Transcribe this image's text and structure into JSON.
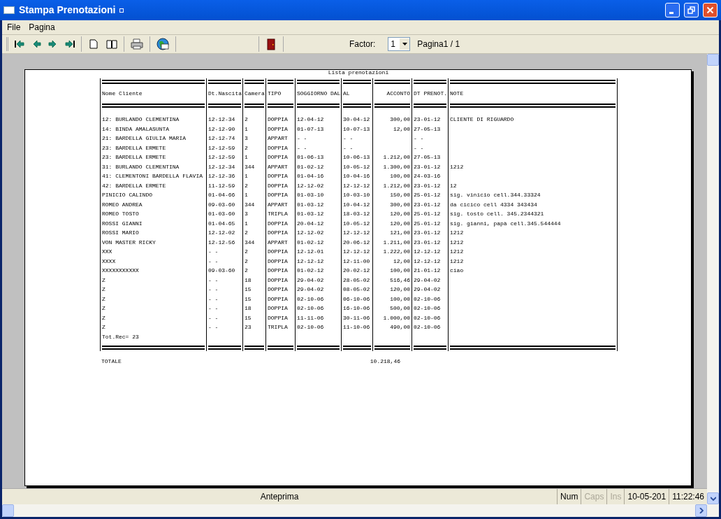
{
  "window": {
    "title": "Stampa Prenotazioni"
  },
  "menu": [
    "File",
    "Pagina"
  ],
  "toolbar": {
    "factor_label": "Factor:",
    "factor_value": "1",
    "page_label": "Pagina1 / 1"
  },
  "report": {
    "title": "Lista prenotazioni",
    "columns": [
      "Nome Cliente",
      "Dt.Nascita",
      "Camera",
      "TIPO",
      "SOGGIORNO DAL",
      "AL",
      "ACCONTO",
      "DT PRENOT.",
      "NOTE"
    ],
    "rows": [
      [
        "12: BURLANDO CLEMENTINA",
        "12-12-34",
        "2",
        "DOPPIA",
        "12-04-12",
        "30-04-12",
        "300,00",
        "23-01-12",
        "CLIENTE DI RIGUARDO"
      ],
      [
        "14: BINDA AMALASUNTA",
        "12-12-90",
        "1",
        "DOPPIA",
        "01-07-13",
        "10-07-13",
        "12,00",
        "27-05-13",
        ""
      ],
      [
        "21: BARDELLA GIULIA MARIA",
        "12-12-74",
        "3",
        "APPART",
        "- -",
        "- -",
        "",
        "- -",
        ""
      ],
      [
        "23: BARDELLA ERMETE",
        "12-12-59",
        "2",
        "DOPPIA",
        "- -",
        "- -",
        "",
        "- -",
        ""
      ],
      [
        "23: BARDELLA ERMETE",
        "12-12-59",
        "1",
        "DOPPIA",
        "01-06-13",
        "10-06-13",
        "1.212,00",
        "27-05-13",
        ""
      ],
      [
        "31: BURLANDO CLEMENTINA",
        "12-12-34",
        "344",
        "APPART",
        "01-02-12",
        "10-05-12",
        "1.300,00",
        "23-01-12",
        "1212"
      ],
      [
        "41: CLEMENTONI BARDELLA FLAVIA",
        "12-12-36",
        "1",
        "DOPPIA",
        "01-04-16",
        "10-04-16",
        "100,00",
        "24-03-16",
        ""
      ],
      [
        "42: BARDELLA ERMETE",
        "11-12-59",
        "2",
        "DOPPIA",
        "12-12-02",
        "12-12-12",
        "1.212,00",
        "23-01-12",
        "12"
      ],
      [
        "PINICIO CALINDO",
        "01-04-66",
        "1",
        "DOPPIA",
        "01-03-10",
        "10-03-10",
        "150,00",
        "25-01-12",
        "sig. vinicio cell.344.33324"
      ],
      [
        "ROMEO ANDREA",
        "09-03-60",
        "344",
        "APPART",
        "01-03-12",
        "10-04-12",
        "300,00",
        "23-01-12",
        "da cicico cell 4334 343434"
      ],
      [
        "ROMEO TOSTO",
        "01-03-60",
        "3",
        "TRIPLA",
        "01-03-12",
        "18-03-12",
        "120,00",
        "25-01-12",
        "sig. tosto cell. 345.2344321"
      ],
      [
        "ROSSI GIANNI",
        "01-04-65",
        "1",
        "DOPPIA",
        "20-04-12",
        "10-05-12",
        "120,00",
        "25-01-12",
        "sig. gianni, papà cell.345.544444"
      ],
      [
        "ROSSI MARIO",
        "12-12-02",
        "2",
        "DOPPIA",
        "12-12-02",
        "12-12-12",
        "121,00",
        "23-01-12",
        "1212"
      ],
      [
        "VON MASTER RICKY",
        "12-12-56",
        "344",
        "APPART",
        "01-02-12",
        "20-06-12",
        "1.211,00",
        "23-01-12",
        "1212"
      ],
      [
        "XXX",
        "- -",
        "2",
        "DOPPIA",
        "12-12-01",
        "12-12-12",
        "1.222,00",
        "12-12-12",
        "1212"
      ],
      [
        "XXXX",
        "- -",
        "2",
        "DOPPIA",
        "12-12-12",
        "12-11-00",
        "12,00",
        "12-12-12",
        "1212"
      ],
      [
        "XXXXXXXXXXX",
        "09-03-60",
        "2",
        "DOPPIA",
        "01-02-12",
        "20-02-12",
        "100,00",
        "21-01-12",
        "ciao"
      ],
      [
        "Z",
        "- -",
        "18",
        "DOPPIA",
        "29-04-02",
        "28-05-02",
        "516,46",
        "29-04-02",
        ""
      ],
      [
        "Z",
        "- -",
        "15",
        "DOPPIA",
        "29-04-02",
        "08-05-02",
        "120,00",
        "29-04-02",
        ""
      ],
      [
        "Z",
        "- -",
        "15",
        "DOPPIA",
        "02-10-06",
        "06-10-06",
        "100,00",
        "02-10-06",
        ""
      ],
      [
        "Z",
        "- -",
        "18",
        "DOPPIA",
        "02-10-06",
        "16-10-06",
        "500,00",
        "02-10-06",
        ""
      ],
      [
        "Z",
        "- -",
        "15",
        "DOPPIA",
        "11-11-06",
        "30-11-06",
        "1.000,00",
        "02-10-06",
        ""
      ],
      [
        "Z",
        "- -",
        "23",
        "TRIPLA",
        "02-10-06",
        "11-10-06",
        "490,00",
        "02-10-06",
        ""
      ]
    ],
    "record_count": "Tot.Rec= 23",
    "total_label": "TOTALE",
    "total_value": "10.218,46"
  },
  "status_bar": [
    {
      "text": "Anteprima",
      "disabled": false
    },
    {
      "text": "Num",
      "disabled": false
    },
    {
      "text": "Caps",
      "disabled": true
    },
    {
      "text": "Ins",
      "disabled": true
    },
    {
      "text": "10-05-201",
      "disabled": false
    },
    {
      "text": "11:22:46",
      "disabled": false
    }
  ]
}
